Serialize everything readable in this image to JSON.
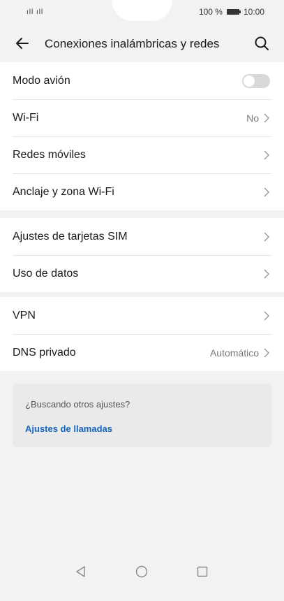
{
  "status_bar": {
    "signal": "ıll ıll",
    "battery_text": "100 %",
    "time": "10:00"
  },
  "app_bar": {
    "title": "Conexiones inalámbricas y redes",
    "back_icon": "arrow-left-icon",
    "search_icon": "search-icon"
  },
  "groups": [
    {
      "rows": [
        {
          "label": "Modo avión",
          "control": "toggle",
          "toggle_on": false
        },
        {
          "label": "Wi-Fi",
          "value": "No",
          "control": "chevron"
        },
        {
          "label": "Redes móviles",
          "control": "chevron"
        },
        {
          "label": "Anclaje y zona Wi-Fi",
          "control": "chevron"
        }
      ]
    },
    {
      "rows": [
        {
          "label": "Ajustes de tarjetas SIM",
          "control": "chevron"
        },
        {
          "label": "Uso de datos",
          "control": "chevron"
        }
      ]
    },
    {
      "rows": [
        {
          "label": "VPN",
          "control": "chevron"
        },
        {
          "label": "DNS privado",
          "value": "Automático",
          "control": "chevron"
        }
      ]
    }
  ],
  "suggestion_card": {
    "hint": "¿Buscando otros ajustes?",
    "link": "Ajustes de llamadas"
  },
  "nav_bar": {
    "back": "triangle-back-icon",
    "home": "circle-home-icon",
    "recents": "square-recents-icon"
  },
  "colors": {
    "background": "#f2f2f2",
    "row_background": "#ffffff",
    "link": "#1565c0",
    "secondary_text": "#7a7a7a"
  }
}
